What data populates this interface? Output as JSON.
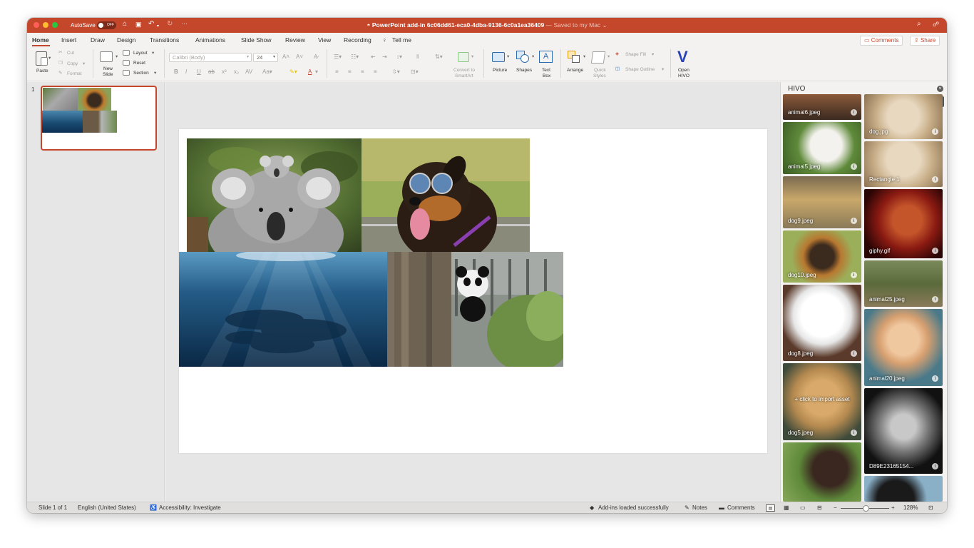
{
  "window": {
    "autosave_label": "AutoSave",
    "autosave_state": "OFF",
    "title": "PowerPoint add-in 6c06dd61-eca0-4dba-9136-6c0a1ea36409",
    "saved_status": "— Saved to my Mac",
    "accent": "#c4472c"
  },
  "tabs": [
    "Home",
    "Insert",
    "Draw",
    "Design",
    "Transitions",
    "Animations",
    "Slide Show",
    "Review",
    "View",
    "Recording"
  ],
  "tell_me": "Tell me",
  "comments_button": "Comments",
  "share_button": "Share",
  "ribbon": {
    "paste": "Paste",
    "cut": "Cut",
    "copy": "Copy",
    "format": "Format",
    "new_slide_1": "New",
    "new_slide_2": "Slide",
    "layout": "Layout",
    "reset": "Reset",
    "section": "Section",
    "font_name": "Calibri (Body)",
    "font_size": "24",
    "convert_1": "Convert to",
    "convert_2": "SmartArt",
    "picture": "Picture",
    "shapes": "Shapes",
    "text_box_1": "Text",
    "text_box_2": "Box",
    "arrange": "Arrange",
    "quick_styles_1": "Quick",
    "quick_styles_2": "Styles",
    "shape_fill": "Shape Fill",
    "shape_outline": "Shape Outline",
    "open_hivo_1": "Open",
    "open_hivo_2": "HIVO",
    "hivo_logo": "V"
  },
  "slides_pane": {
    "slide_number": "1"
  },
  "hivo_pane": {
    "title": "HIVO",
    "info_icon": "i",
    "import_hint": "+ click to import asset",
    "left_column": [
      "animal6.jpeg",
      "animal5.jpeg",
      "dog9.jpeg",
      "dog10.jpeg",
      "dog8.jpeg",
      "dog5.jpeg",
      ""
    ],
    "right_column": [
      "dog.jpg",
      "Rectangle 1",
      "giphy.gif",
      "animal25.jpeg",
      "animal20.jpeg",
      "D89E23165154...",
      ""
    ]
  },
  "statusbar": {
    "slide": "Slide 1 of 1",
    "language": "English (United States)",
    "accessibility": "Accessibility: Investigate",
    "addins": "Add-ins loaded successfully",
    "notes": "Notes",
    "comments": "Comments",
    "zoom": "128%"
  }
}
